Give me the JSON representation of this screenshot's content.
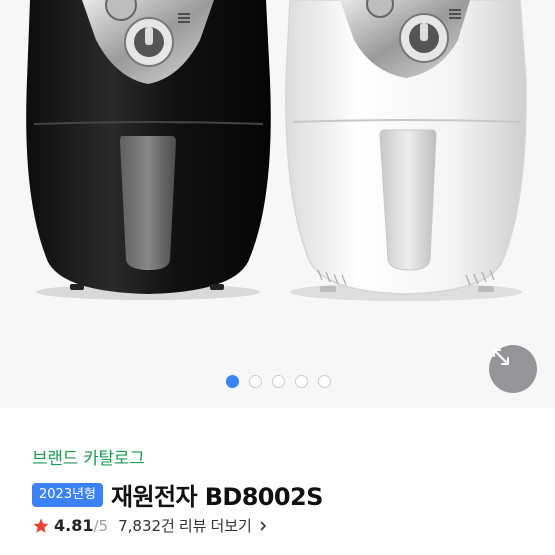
{
  "gallery": {
    "total_images": 5,
    "active_index": 0
  },
  "icons": {
    "zoom": "expand-arrows-icon",
    "star": "star-icon",
    "chevron": "chevron-right-icon"
  },
  "product": {
    "brand_catalog_label": "브랜드 카탈로그",
    "year_badge": "2023년형",
    "name": "재원전자 BD8002S",
    "rating": "4.81",
    "rating_max": "/5",
    "review_count": "7,832건",
    "review_label": "리뷰",
    "review_more": "더보기"
  },
  "colors": {
    "brand_link": "#1c9a58",
    "badge_bg": "#3b82f6",
    "star": "#e8443a",
    "active_dot": "#3b82f6"
  }
}
